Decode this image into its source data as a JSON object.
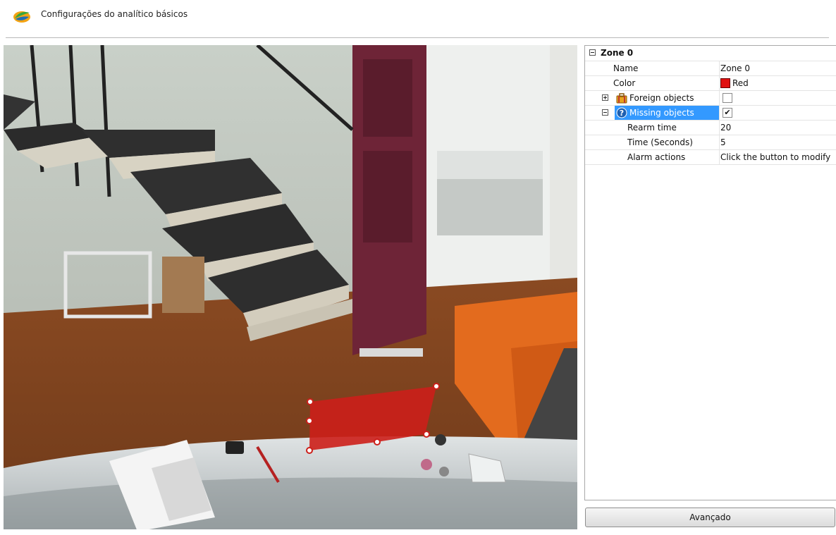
{
  "header": {
    "title": "Configurações do analítico básicos",
    "logo_icon": "app-logo-icon"
  },
  "props": {
    "group": {
      "label": "Zone 0"
    },
    "name": {
      "label": "Name",
      "value": "Zone 0"
    },
    "color": {
      "label": "Color",
      "value": "Red",
      "swatch": "#e01010"
    },
    "foreign": {
      "label": "Foreign objects",
      "checked": false,
      "icon": "suitcase-icon"
    },
    "missing": {
      "label": "Missing objects",
      "checked": true,
      "check_glyph": "✔",
      "icon": "question-icon"
    },
    "rearm": {
      "label": "Rearm time",
      "value": "20"
    },
    "time": {
      "label": "Time (Seconds)",
      "value": "5"
    },
    "alarm": {
      "label": "Alarm actions",
      "value": "Click the button to modify"
    }
  },
  "buttons": {
    "advanced": "Avançado"
  },
  "zone_overlay": {
    "color": "#cc1f1a"
  }
}
